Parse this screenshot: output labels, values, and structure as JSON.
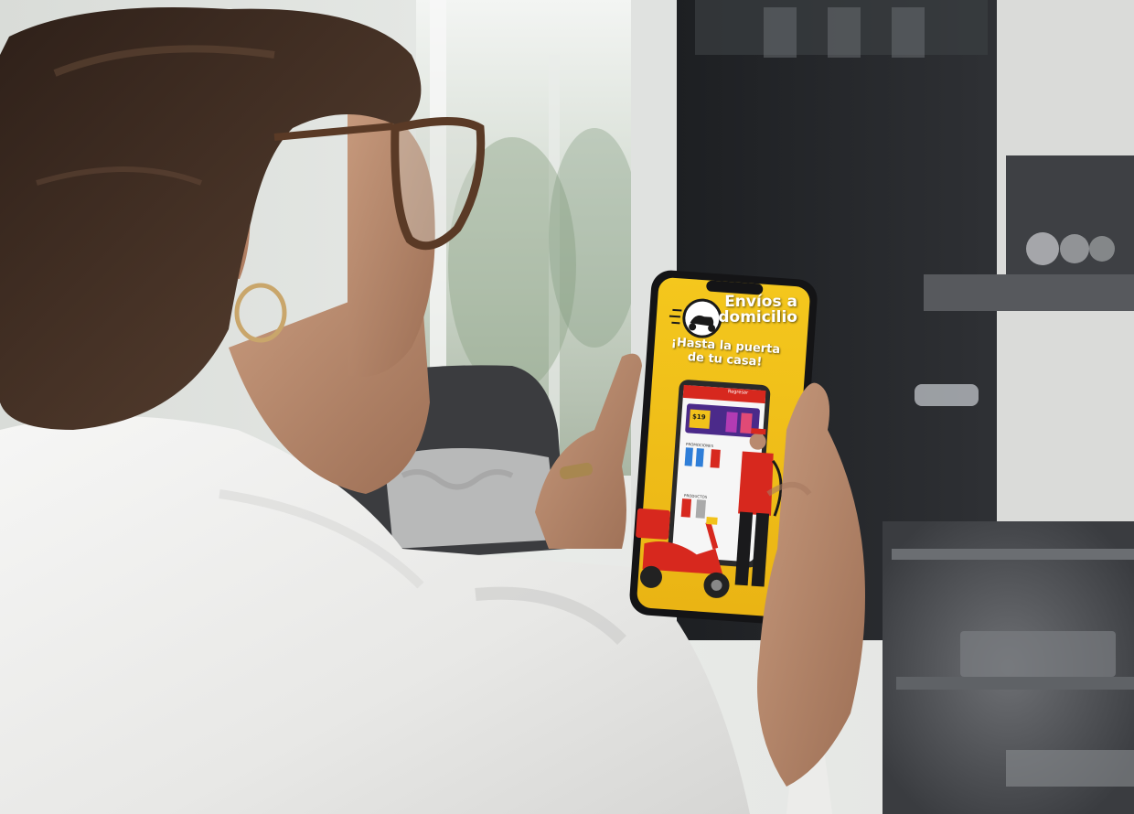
{
  "photo": {
    "subject": "woman-holding-smartphone",
    "colors": {
      "wall": "#e9ebea",
      "window_glow": "#f4f6f4",
      "plant_green": "#8aa07e",
      "dark_cabinet": "#2b2d30",
      "shelf_gray": "#4a4c50",
      "sofa_dark": "#3a3b3d",
      "shirt_white": "#f1f1f0",
      "hair_dark": "#3a2a22",
      "skin": "#b98a6e",
      "phone_body": "#1a1a1c",
      "screen_yellow": "#f2c21b",
      "screen_red": "#d7281e"
    }
  },
  "phone_screen": {
    "headline_line1": "Envíos a",
    "headline_line2": "domicilio",
    "subline_line1": "¡Hasta la puerta",
    "subline_line2": "de tu casa!",
    "badge_icon": "scooter-delivery-icon",
    "inner_app": {
      "header": "Regresar",
      "promo_price": "$19",
      "section_promos": "PROMOCIONES",
      "section_products": "PRODUCTOS"
    }
  }
}
